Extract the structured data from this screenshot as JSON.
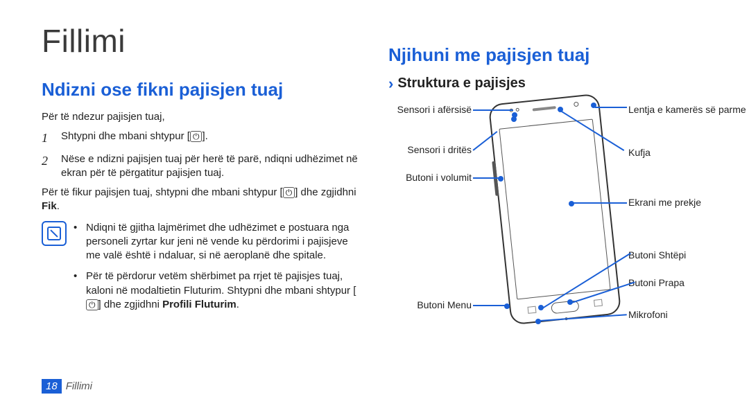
{
  "title": "Fillimi",
  "left": {
    "section_title": "Ndizni ose fikni pajisjen tuaj",
    "intro": "Për të ndezur pajisjen tuaj,",
    "step1_num": "1",
    "step1_text": "Shtypni dhe mbani shtypur [",
    "step1_text2": "].",
    "step2_num": "2",
    "step2_text": "Nëse e ndizni pajisjen tuaj për herë të parë, ndiqni udhëzimet në ekran për të përgatitur pajisjen tuaj.",
    "off_text1": "Për të fikur pajisjen tuaj, shtypni dhe mbani shtypur [",
    "off_text2": "] dhe zgjidhni ",
    "off_bold": "Fik",
    "off_text3": ".",
    "bullet1_a": "Ndiqni të gjitha lajmërimet dhe udhëzimet e postuara nga personeli zyrtar kur jeni në vende ku përdorimi i pajisjeve me valë është i ndaluar, si në aeroplanë dhe spitale.",
    "bullet2_a": "Për të përdorur vetëm shërbimet pa rrjet të pajisjes tuaj, kaloni në modaltietin Fluturim. Shtypni dhe mbani shtypur [",
    "bullet2_b": "] dhe zgjidhni ",
    "bullet2_bold": "Profili Fluturim",
    "bullet2_c": "."
  },
  "right": {
    "section_title": "Njihuni me pajisjen tuaj",
    "sub_title": "Struktura e pajisjes",
    "labels": {
      "proximity": "Sensori i afërsisë",
      "light": "Sensori i dritës",
      "volume": "Butoni i volumit",
      "menu": "Butoni Menu",
      "front_cam": "Lentja e kamerës\nsë parme",
      "earpiece": "Kufja",
      "screen": "Ekrani me prekje",
      "home": "Butoni Shtëpi",
      "back": "Butoni Prapa",
      "mic": "Mikrofoni"
    }
  },
  "footer": {
    "page": "18",
    "name": "Fillimi"
  }
}
